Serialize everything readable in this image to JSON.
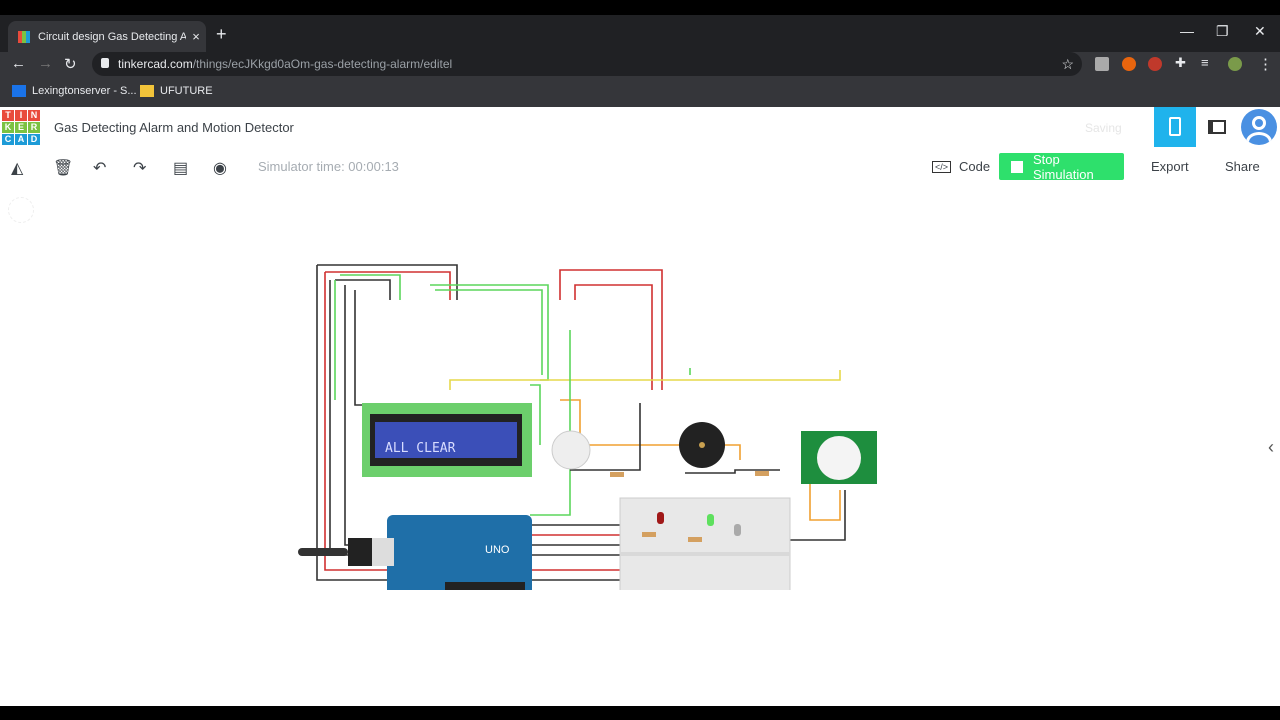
{
  "browser": {
    "tab_title": "Circuit design Gas Detecting Alarm and Motion Detector",
    "new_tab": "+",
    "close_tab": "×",
    "url_host": "tinkercad.com",
    "url_path": "/things/ecJKkgd0aOm-gas-detecting-alarm/editel",
    "bookmarks": [
      {
        "label": "Lexingtonserver - S...",
        "icon_color": "#1a73e8"
      },
      {
        "label": "UFUTURE",
        "icon_color": "#f2c43a"
      }
    ]
  },
  "app": {
    "logo_letters": [
      "T",
      "I",
      "N",
      "K",
      "E",
      "R",
      "C",
      "A",
      "D"
    ],
    "logo_colors": [
      "#e94b3c",
      "#e94b3c",
      "#e94b3c",
      "#7cc242",
      "#7cc242",
      "#7cc242",
      "#1d9bd7",
      "#1d9bd7",
      "#1d9bd7"
    ],
    "design_title": "Gas Detecting Alarm and Motion Detector",
    "status": "Saving",
    "simulator_time": "Simulator time: 00:00:13",
    "code_label": "Code",
    "stop_label": "Stop Simulation",
    "export_label": "Export",
    "share_label": "Share",
    "lcd_text": "ALL CLEAR",
    "arduino_label": "UNO",
    "accent": "#1fb3ec",
    "stop_color": "#2ee06c"
  }
}
